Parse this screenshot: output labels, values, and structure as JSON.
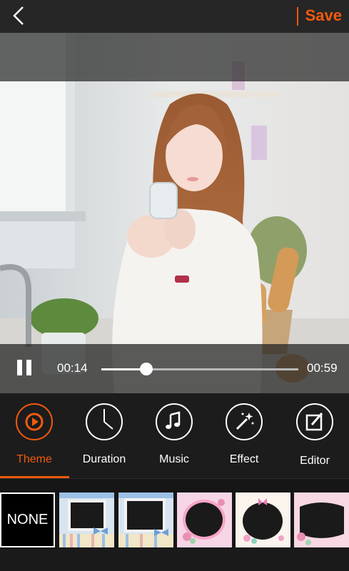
{
  "header": {
    "save_label": "Save"
  },
  "player": {
    "current_time": "00:14",
    "total_time": "00:59",
    "progress": 0.23
  },
  "tools": [
    {
      "label": "Theme",
      "icon": "play-circle-icon",
      "active": true
    },
    {
      "label": "Duration",
      "icon": "clock-icon",
      "active": false
    },
    {
      "label": "Music",
      "icon": "music-note-icon",
      "active": false
    },
    {
      "label": "Effect",
      "icon": "magic-wand-icon",
      "active": false
    },
    {
      "label": "Editor",
      "icon": "edit-icon",
      "active": false
    }
  ],
  "themes": [
    {
      "label": "NONE"
    },
    {
      "label": ""
    },
    {
      "label": ""
    },
    {
      "label": ""
    },
    {
      "label": ""
    },
    {
      "label": ""
    }
  ],
  "colors": {
    "accent": "#f05a0e",
    "background": "#1c1c1c"
  }
}
